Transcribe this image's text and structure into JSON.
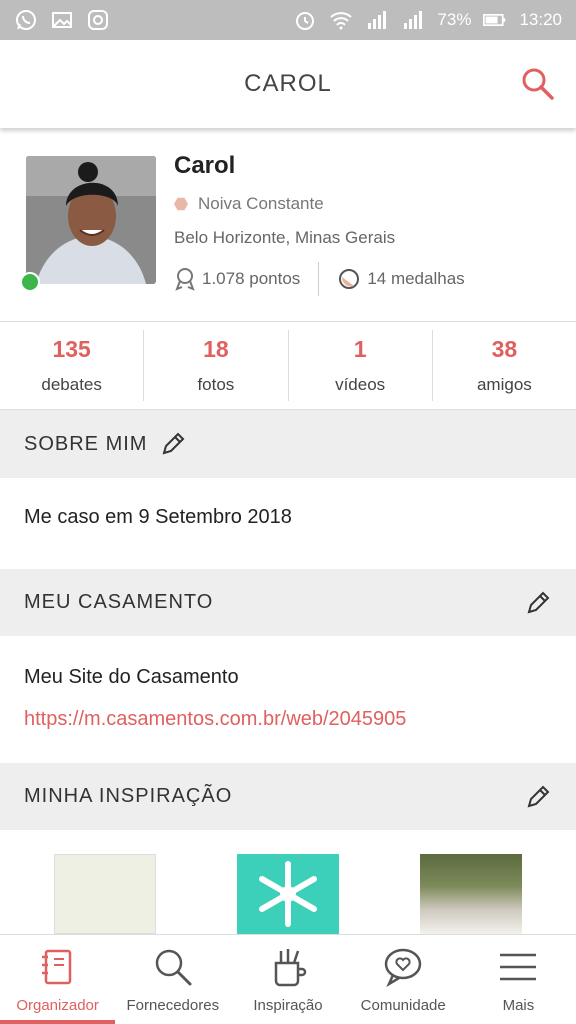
{
  "status_bar": {
    "battery": "73%",
    "time": "13:20"
  },
  "app_bar": {
    "title": "CAROL"
  },
  "profile": {
    "name": "Carol",
    "rank": "Noiva Constante",
    "location": "Belo Horizonte, Minas Gerais",
    "points": "1.078 pontos",
    "medals": "14 medalhas"
  },
  "counts": [
    {
      "value": "135",
      "label": "debates"
    },
    {
      "value": "18",
      "label": "fotos"
    },
    {
      "value": "1",
      "label": "vídeos"
    },
    {
      "value": "38",
      "label": "amigos"
    }
  ],
  "sobre_mim": {
    "heading": "SOBRE MIM",
    "text": "Me caso em 9 Setembro 2018"
  },
  "meu_casamento": {
    "heading": "MEU CASAMENTO",
    "site_label": "Meu Site do Casamento",
    "site_url": "https://m.casamentos.com.br/web/2045905"
  },
  "minha_inspiracao": {
    "heading": "MINHA INSPIRAÇÃO"
  },
  "bottom_nav": [
    {
      "label": "Organizador",
      "active": true
    },
    {
      "label": "Fornecedores"
    },
    {
      "label": "Inspiração"
    },
    {
      "label": "Comunidade"
    },
    {
      "label": "Mais"
    }
  ],
  "colors": {
    "accent": "#e0605f",
    "online": "#3cb54a",
    "status_bar": "#bdbdbd",
    "section_bg": "#eeeeee"
  }
}
